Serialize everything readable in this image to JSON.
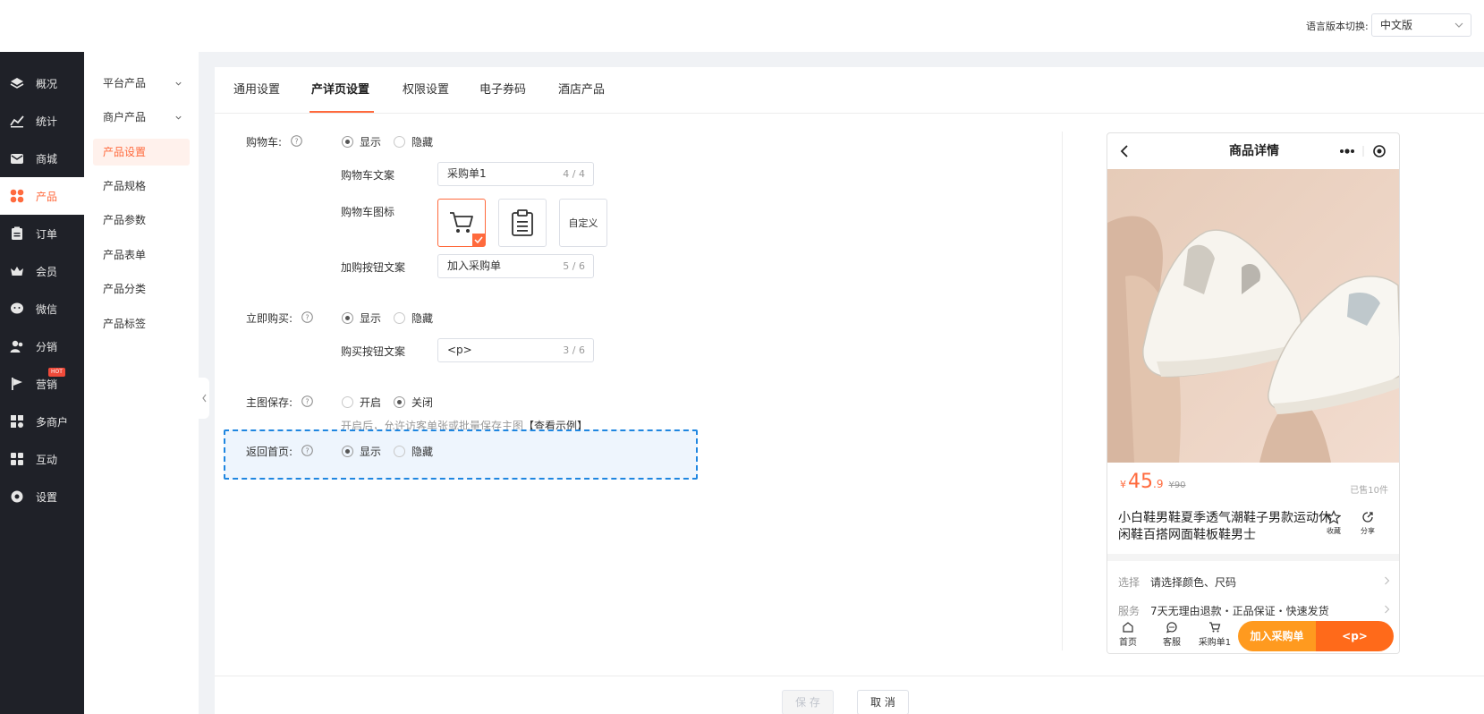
{
  "header": {
    "lang_label": "语言版本切换:",
    "lang_value": "中文版"
  },
  "nav": [
    {
      "label": "概况",
      "icon": "layers-icon"
    },
    {
      "label": "统计",
      "icon": "chart-icon"
    },
    {
      "label": "商城",
      "icon": "mail-icon"
    },
    {
      "label": "产品",
      "icon": "grid-icon"
    },
    {
      "label": "订单",
      "icon": "order-icon"
    },
    {
      "label": "会员",
      "icon": "crown-icon"
    },
    {
      "label": "微信",
      "icon": "wechat-icon"
    },
    {
      "label": "分销",
      "icon": "users-icon"
    },
    {
      "label": "营销",
      "icon": "flag-icon",
      "badge": "HOT"
    },
    {
      "label": "多商户",
      "icon": "shops-icon"
    },
    {
      "label": "互动",
      "icon": "apps-icon"
    },
    {
      "label": "设置",
      "icon": "gear-icon"
    }
  ],
  "subnav": [
    {
      "label": "平台产品",
      "expandable": true
    },
    {
      "label": "商户产品",
      "expandable": true
    },
    {
      "label": "产品设置"
    },
    {
      "label": "产品规格"
    },
    {
      "label": "产品参数"
    },
    {
      "label": "产品表单"
    },
    {
      "label": "产品分类"
    },
    {
      "label": "产品标签"
    }
  ],
  "tabs": [
    "通用设置",
    "产详页设置",
    "权限设置",
    "电子券码",
    "酒店产品"
  ],
  "form": {
    "cart_label": "购物车:",
    "show": "显示",
    "hide": "隐藏",
    "cart_text_label": "购物车文案",
    "cart_text_value": "采购单1",
    "cart_text_count": "4 / 4",
    "cart_icon_label": "购物车图标",
    "custom_label": "自定义",
    "add_btn_label": "加购按钮文案",
    "add_btn_value": "加入采购单",
    "add_btn_count": "5 / 6",
    "buy_now_label": "立即购买:",
    "buy_btn_label": "购买按钮文案",
    "buy_btn_value": "<p>",
    "buy_btn_count": "3 / 6",
    "img_save_label": "主图保存:",
    "on": "开启",
    "off": "关闭",
    "img_save_hint": "开启后，允许访客单张或批量保存主图",
    "img_save_link": "【查看示例】",
    "home_label": "返回首页:"
  },
  "buttons": {
    "save": "保 存",
    "cancel": "取 消"
  },
  "preview": {
    "title": "商品详情",
    "price_currency": "¥",
    "price_int": "45",
    "price_dec": ".9",
    "price_orig": "¥90",
    "sold": "已售10件",
    "product_title": "小白鞋男鞋夏季透气潮鞋子男款运动休闲鞋百搭网面鞋板鞋男士",
    "fav": "收藏",
    "share": "分享",
    "select_k": "选择",
    "select_v": "请选择颜色、尺码",
    "service_k": "服务",
    "service_v": "7天无理由退款・正品保证・快速发货",
    "bar_home": "首页",
    "bar_service": "客服",
    "bar_cart": "采购单1",
    "btn_add": "加入采购单",
    "btn_buy": "<p>"
  },
  "colors": {
    "accent": "#ff6a3d",
    "nav_bg": "#1f2128",
    "selection": "#1f86e0"
  }
}
